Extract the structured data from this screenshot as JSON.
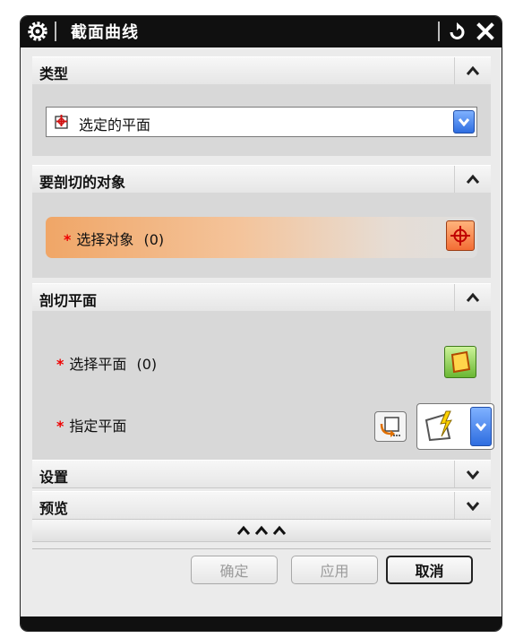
{
  "window": {
    "title": "截面曲线",
    "icons": [
      "gear-icon",
      "reset-icon",
      "close-icon"
    ]
  },
  "sections": {
    "type": {
      "header": "类型",
      "dropdown_value": "选定的平面"
    },
    "objects": {
      "header": "要剖切的对象",
      "select_label": "选择对象",
      "select_count": "(0)",
      "required_mark": "*"
    },
    "plane": {
      "header": "剖切平面",
      "select_plane_label": "选择平面",
      "select_plane_count": "(0)",
      "specify_plane_label": "指定平面",
      "required_mark": "*"
    },
    "settings": {
      "header": "设置"
    },
    "preview": {
      "header": "预览"
    }
  },
  "expand_bar": {
    "glyph": "^^^"
  },
  "buttons": {
    "ok": "确定",
    "apply": "应用",
    "cancel": "取消"
  },
  "colors": {
    "title_bar": "#101010",
    "select_highlight": "#f0a667",
    "required_star": "#e00000",
    "dropdown_arrow": "#2e6de0"
  }
}
